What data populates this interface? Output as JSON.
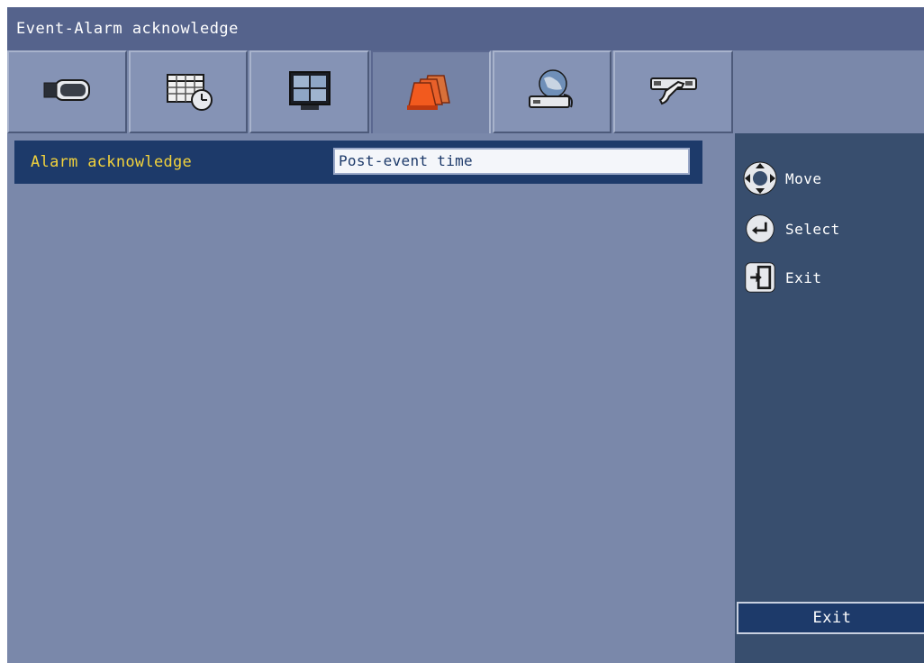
{
  "window": {
    "title": "Event-Alarm acknowledge"
  },
  "tabs": [
    {
      "icon": "camera-icon",
      "active": false
    },
    {
      "icon": "schedule-calendar-icon",
      "active": false
    },
    {
      "icon": "monitor-icon",
      "active": false
    },
    {
      "icon": "alarm-light-icon",
      "active": true
    },
    {
      "icon": "network-globe-icon",
      "active": false
    },
    {
      "icon": "system-tools-icon",
      "active": false
    }
  ],
  "settings": [
    {
      "label": "Alarm acknowledge",
      "value": "Post-event time"
    }
  ],
  "help": {
    "move": "Move",
    "select": "Select",
    "exit": "Exit"
  },
  "footer": {
    "exit_label": "Exit"
  },
  "colors": {
    "titlebar": "#55638c",
    "panel": "#7a88aa",
    "sidebar": "#384e6e",
    "selected_row": "#1d3a6a",
    "label_text": "#f2d23c"
  }
}
